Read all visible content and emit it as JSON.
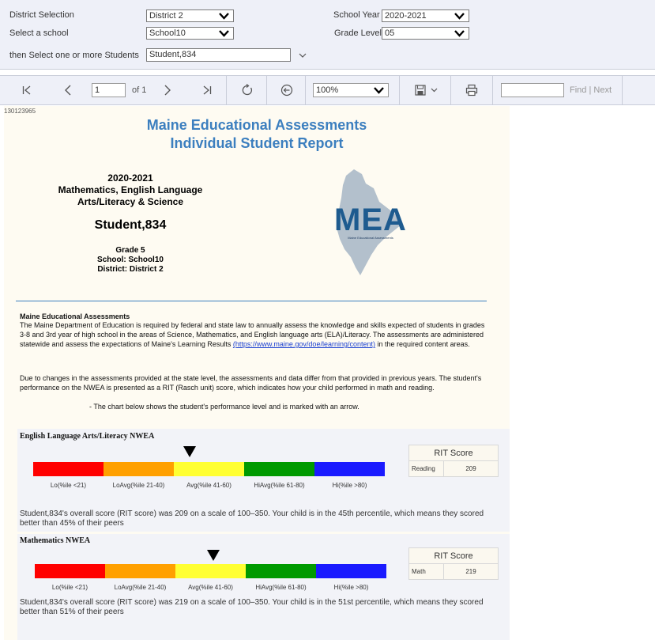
{
  "params": {
    "district_label": "District Selection",
    "district_value": "District 2",
    "school_label": "Select a school",
    "school_value": "School10",
    "students_label": "then Select one or more Students",
    "students_value": "Student,834",
    "year_label": "School Year",
    "year_value": "2020-2021",
    "grade_label": "Grade Level",
    "grade_value": "05"
  },
  "toolbar": {
    "page_value": "1",
    "page_of": "of 1",
    "zoom_value": "100%",
    "find_link": "Find",
    "next_link": "Next",
    "find_sep": "|"
  },
  "report": {
    "id": "130123965",
    "title1": "Maine Educational Assessments",
    "title2": "Individual Student Report",
    "year": "2020-2021",
    "subjects1": "Mathematics, English Language",
    "subjects2": "Arts/Literacy & Science",
    "student": "Student,834",
    "grade": "Grade 5",
    "school": "School: School10",
    "district": "District: District 2",
    "logo_text": "MEA",
    "logo_sub": "Maine Educational Assessments",
    "intro_heading": "Maine Educational Assessments",
    "intro_p1": "The Maine Department of Education is required by federal and state law to annually assess the knowledge and skills expected of students in grades 3-8 and 3rd year of high school in the areas of Science, Mathematics, and English language arts (ELA)/Literacy. The assessments are administered statewide and assess the expectations of Maine's Learning Results",
    "intro_link": "(https://www.maine.gov/doe/learning/content)",
    "intro_p1_end": "in the required content areas.",
    "intro_p2": "Due to changes in the assessments provided at the state level, the assessments and data differ from that provided in previous years. The student's performance on the NWEA is presented as a RIT (Rasch unit) score, which indicates how your child performed in math and reading.",
    "intro_bullet": "-   The chart below shows the student's performance level and is marked with an arrow."
  },
  "bands": [
    {
      "label": "Lo(%ile <21)",
      "color": "#ff0000"
    },
    {
      "label": "LoAvg(%ile 21-40)",
      "color": "#ffa000"
    },
    {
      "label": "Avg(%ile 41-60)",
      "color": "#ffff33"
    },
    {
      "label": "HiAvg(%ile 61-80)",
      "color": "#009a00"
    },
    {
      "label": "Hi(%ile >80)",
      "color": "#1a1aff"
    }
  ],
  "ela": {
    "title": "English Language Arts/Literacy NWEA",
    "rit_header": "RIT Score",
    "rit_subject": "Reading",
    "rit_value": "209",
    "percentile": 45,
    "summary": "Student,834's overall score (RIT score) was 209 on a scale of 100–350. Your child is in the 45th percentile, which means they scored better than 45% of their peers"
  },
  "math": {
    "title": "Mathematics NWEA",
    "rit_header": "RIT Score",
    "rit_subject": "Math",
    "rit_value": "219",
    "percentile": 51,
    "summary": "Student,834's overall score (RIT score) was 219 on a scale of 100–350. Your child is in the 51st percentile, which means they scored better than 51% of their peers"
  }
}
